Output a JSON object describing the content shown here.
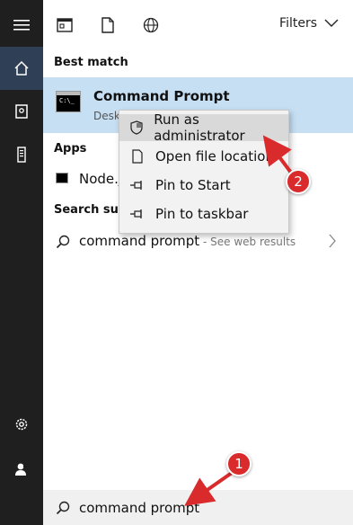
{
  "rail": {
    "items": [
      {
        "name": "hamburger-menu"
      },
      {
        "name": "home"
      },
      {
        "name": "documents"
      },
      {
        "name": "device"
      },
      {
        "name": "settings"
      },
      {
        "name": "user"
      }
    ]
  },
  "topbar": {
    "filters_label": "Filters"
  },
  "sections": {
    "best_match": "Best match",
    "apps": "Apps",
    "search_suggestions": "Search sugg"
  },
  "best_match": {
    "title": "Command Prompt",
    "subtitle": "Desk",
    "icon_text": "C:\\_"
  },
  "apps": {
    "item_label": "Node.j"
  },
  "suggestion": {
    "query": "command prompt",
    "suffix": " - See web results"
  },
  "context_menu": {
    "items": [
      {
        "label": "Run as administrator",
        "icon": "shield-icon"
      },
      {
        "label": "Open file location",
        "icon": "file-icon"
      },
      {
        "label": "Pin to Start",
        "icon": "pin-icon"
      },
      {
        "label": "Pin to taskbar",
        "icon": "pin-icon"
      }
    ]
  },
  "search": {
    "value": "command prompt"
  },
  "annotations": {
    "badge1": "1",
    "badge2": "2"
  },
  "colors": {
    "accent": "#d92b2b",
    "selection": "#c6dff2",
    "rail": "#1f1f1f"
  }
}
